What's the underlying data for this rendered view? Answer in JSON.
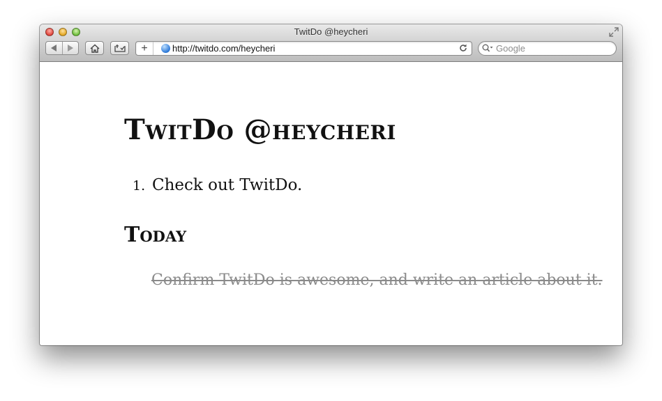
{
  "window": {
    "title": "TwitDo @heycheri"
  },
  "toolbar": {
    "address_url": "http://twitdo.com/heycheri",
    "add_label": "+",
    "search_placeholder": "Google"
  },
  "page": {
    "heading": "TwitDo @heycheri",
    "todo_items": [
      {
        "number": "1.",
        "text": "Check out TwitDo."
      }
    ],
    "today_heading": "Today",
    "completed_items": [
      {
        "text": "Confirm TwitDo is awesome, and write an article about it."
      }
    ]
  },
  "colors": {
    "completed_text": "#8a8a8a",
    "heading_text": "#111111"
  }
}
